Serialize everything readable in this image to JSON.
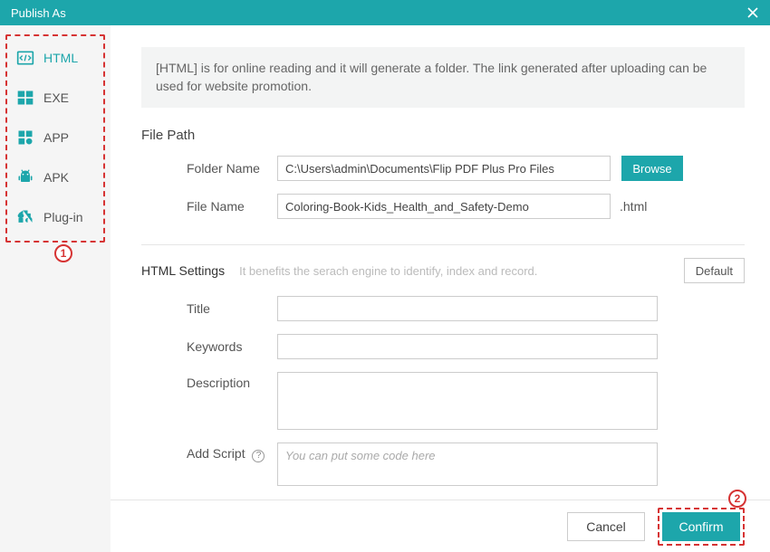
{
  "window": {
    "title": "Publish As"
  },
  "sidebar": {
    "items": [
      {
        "label": "HTML"
      },
      {
        "label": "EXE"
      },
      {
        "label": "APP"
      },
      {
        "label": "APK"
      },
      {
        "label": "Plug-in"
      }
    ]
  },
  "info": {
    "text": "[HTML] is for online reading and it will generate a folder. The link generated after uploading can be used for website promotion."
  },
  "filepath": {
    "section": "File Path",
    "folder_label": "Folder Name",
    "folder_value": "C:\\Users\\admin\\Documents\\Flip PDF Plus Pro Files",
    "browse": "Browse",
    "file_label": "File Name",
    "file_value": "Coloring-Book-Kids_Health_and_Safety-Demo",
    "file_suffix": ".html"
  },
  "settings": {
    "section": "HTML Settings",
    "hint": "It benefits the serach engine to identify, index and record.",
    "default_btn": "Default",
    "title_label": "Title",
    "keywords_label": "Keywords",
    "desc_label": "Description",
    "script_label": "Add Script",
    "script_placeholder": "You can put some code here"
  },
  "footer": {
    "cancel": "Cancel",
    "confirm": "Confirm"
  },
  "annotations": {
    "one": "1",
    "two": "2"
  }
}
